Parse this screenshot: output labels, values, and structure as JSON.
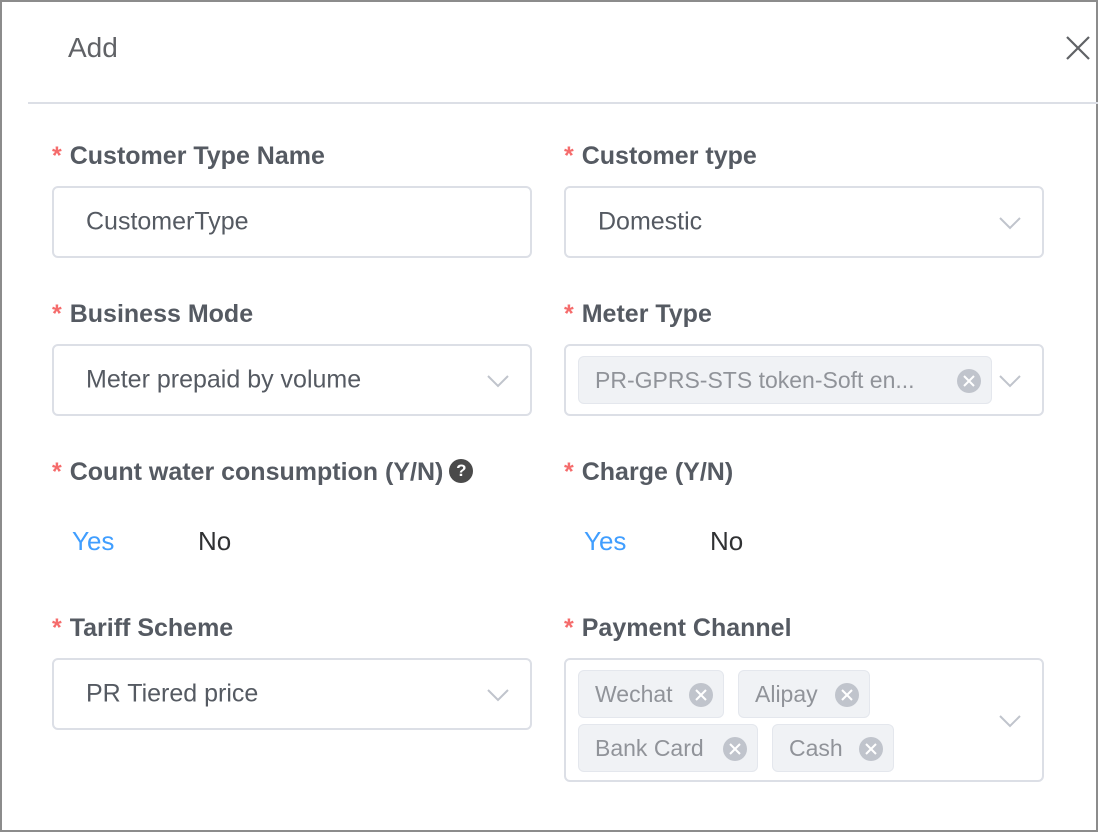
{
  "dialog": {
    "title": "Add",
    "close_icon": "close-icon"
  },
  "form": {
    "required_mark": "*",
    "customer_type_name": {
      "label": "Customer Type Name",
      "value": "CustomerType"
    },
    "customer_type": {
      "label": "Customer type",
      "value": "Domestic"
    },
    "business_mode": {
      "label": "Business Mode",
      "value": "Meter prepaid by volume"
    },
    "meter_type": {
      "label": "Meter Type",
      "tags": [
        "PR-GPRS-STS token-Soft en..."
      ]
    },
    "count_water": {
      "label": "Count water consumption (Y/N)",
      "help_icon": "?",
      "options": [
        "Yes",
        "No"
      ],
      "selected": "Yes"
    },
    "charge": {
      "label": "Charge (Y/N)",
      "options": [
        "Yes",
        "No"
      ],
      "selected": "Yes"
    },
    "tariff_scheme": {
      "label": "Tariff Scheme",
      "value": "PR Tiered price"
    },
    "payment_channel": {
      "label": "Payment Channel",
      "tags": [
        "Wechat",
        "Alipay",
        "Bank Card",
        "Cash"
      ]
    }
  },
  "colors": {
    "required": "#f56c6c",
    "active_option": "#409eff",
    "border": "#dcdfe6"
  }
}
